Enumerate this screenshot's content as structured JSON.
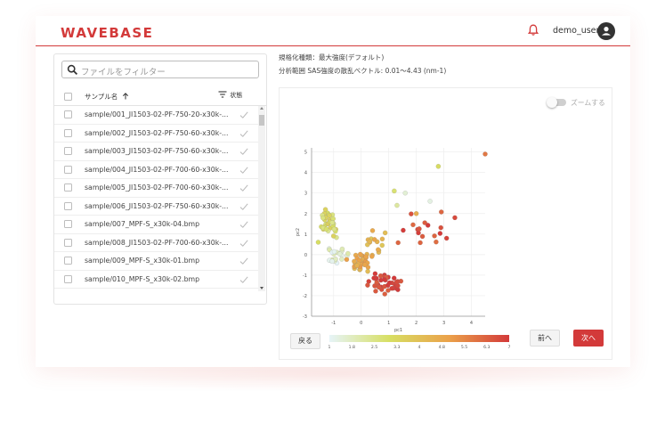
{
  "header": {
    "logo": "WAVEBASE",
    "username": "demo_user",
    "icons": [
      "bell-icon",
      "account-icon"
    ],
    "accent_color": "#d33a3a"
  },
  "filter": {
    "placeholder": "ファイルをフィルター"
  },
  "table": {
    "col_name": "サンプル名",
    "col_status": "状態",
    "rows": [
      "sample/001_JI1503-02-PF-750-20-x30k-...",
      "sample/002_JI1503-02-PF-750-60-x30k-...",
      "sample/003_JI1503-02-PF-750-60-x30k-...",
      "sample/004_JI1503-02-PF-700-60-x30k-...",
      "sample/005_JI1503-02-PF-700-60-x30k-...",
      "sample/006_JI1503-02-PF-750-60-x30k-...",
      "sample/007_MPF-S_x30k-04.bmp",
      "sample/008_JI1503-02-PF-700-60-x30k-...",
      "sample/009_MPF-S_x30k-01.bmp",
      "sample/010_MPF-S_x30k-02.bmp"
    ]
  },
  "info": {
    "normalization": "規格化種類：最大強度(デフォルト)",
    "range": "分析範囲 SAS強度の散乱ベクトル: 0.01～4.43 (nm-1)"
  },
  "zoom": {
    "label": "ズームする",
    "enabled": false
  },
  "buttons": {
    "back": "戻る",
    "prev": "前へ",
    "next": "次へ"
  },
  "chart_data": {
    "type": "scatter",
    "xlabel": "pc1",
    "ylabel": "pc2",
    "xlim": [
      -1.8,
      4.5
    ],
    "ylim": [
      -3,
      5.2
    ],
    "xticks": [
      "-1",
      "0",
      "1",
      "2",
      "3",
      "4"
    ],
    "yticks": [
      "-3",
      "-2",
      "-1",
      "0",
      "1",
      "2",
      "3",
      "4",
      "5"
    ],
    "grid": true,
    "colorbar": {
      "ticks": [
        "1",
        "1.8",
        "2.5",
        "3.3",
        "4",
        "4.8",
        "5.5",
        "6.3",
        "7"
      ],
      "range": [
        1,
        7
      ],
      "colors": [
        "#e6f4f8",
        "#d7df63",
        "#eba14a",
        "#d33a3a"
      ]
    }
  }
}
